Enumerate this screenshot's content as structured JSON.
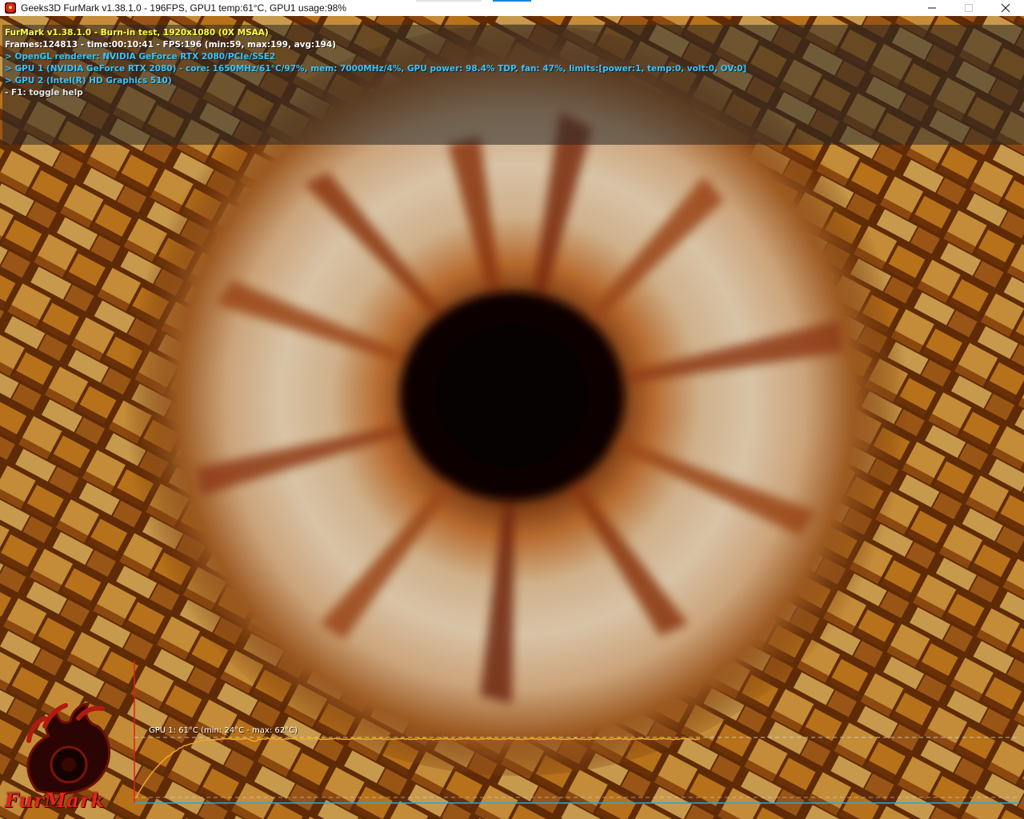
{
  "window": {
    "title": "Geeks3D FurMark v1.38.1.0 - 196FPS, GPU1 temp:61°C, GPU1 usage:98%",
    "icon": "furmark-app-icon",
    "controls": {
      "minimize": "—",
      "maximize": "☐",
      "close": "✕"
    }
  },
  "overlay": {
    "lines": [
      "FurMark v1.38.1.0 - Burn-in test, 1920x1080 (0X MSAA)",
      "Frames:124813 - time:00:10:41 - FPS:196 (min:59, max:199, avg:194)",
      "> OpenGL renderer: NVIDIA GeForce RTX 2080/PCIe/SSE2",
      "> GPU 1 (NVIDIA GeForce RTX 2080) - core: 1650MHz/61°C/97%, mem: 7000MHz/4%, GPU power: 98.4% TDP, fan: 47%, limits:[power:1, temp:0, volt:0, OV:0]",
      "> GPU 2 (Intel(R) HD Graphics 510)",
      "- F1: toggle help"
    ],
    "colors": {
      "title": "#ffff3c",
      "stats": "#ffffff",
      "gpu": "#36c4ff",
      "help": "#e6e6e6"
    }
  },
  "temperature_graph": {
    "label": "GPU 1: 61°C (min: 24°C - max: 62°C)",
    "current_temp_c": 61,
    "min_temp_c": 24,
    "max_temp_c": 62,
    "line_color": "#f5a623",
    "axis_color_vertical": "#e0201a",
    "axis_color_horizontal": "#29a8d8"
  },
  "logo": {
    "text": "FurMark",
    "icon": "furmark-logo-icon",
    "color": "#e1261a"
  }
}
